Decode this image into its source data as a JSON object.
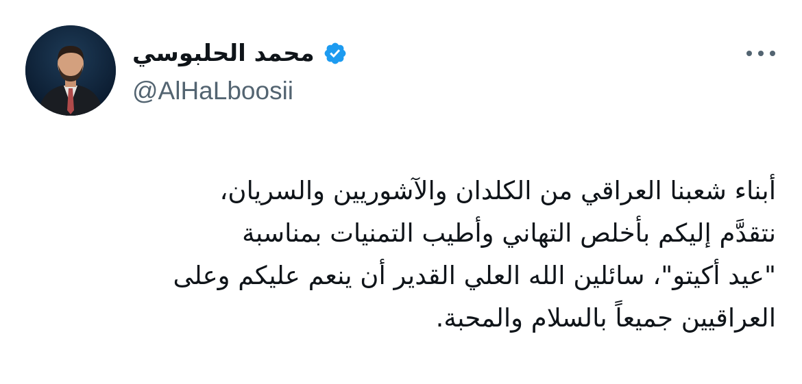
{
  "author": {
    "display_name": "محمد الحلبوسي",
    "handle": "@AlHaLboosii",
    "verified": true,
    "avatar_icon": "profile-photo"
  },
  "menu": {
    "icon": "more-horizontal-icon"
  },
  "tweet": {
    "lines": [
      "أبناء شعبنا العراقي من الكلدان والآشوريين والسريان،",
      "نتقدَّم إليكم بأخلص التهاني وأطيب التمنيات بمناسبة",
      "\"عيد أكيتو\"، سائلين الله العلي القدير أن ينعم عليكم وعلى",
      "العراقيين جميعاً بالسلام والمحبة."
    ]
  },
  "colors": {
    "verified_badge": "#1d9bf0",
    "text_primary": "#0f1419",
    "text_secondary": "#536471"
  }
}
